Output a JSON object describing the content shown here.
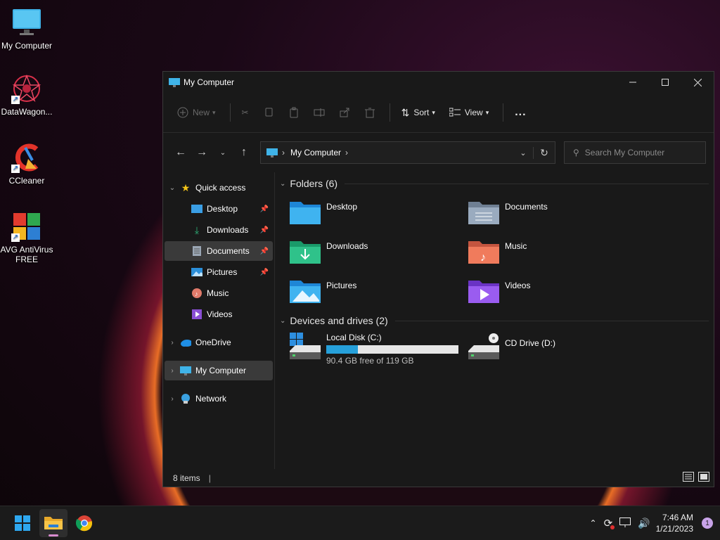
{
  "desktop": {
    "icons": [
      {
        "label": "My Computer"
      },
      {
        "label": "DataWagon..."
      },
      {
        "label": "CCleaner"
      },
      {
        "label": "AVG AntiVirus FREE"
      }
    ]
  },
  "window": {
    "title": "My Computer",
    "toolbar": {
      "new_label": "New",
      "sort_label": "Sort",
      "view_label": "View",
      "more_label": "..."
    },
    "address": {
      "crumb": "My Computer"
    },
    "search": {
      "placeholder": "Search My Computer"
    },
    "nav": {
      "quick_access": "Quick access",
      "desktop": "Desktop",
      "downloads": "Downloads",
      "documents": "Documents",
      "pictures": "Pictures",
      "music": "Music",
      "videos": "Videos",
      "onedrive": "OneDrive",
      "my_computer": "My Computer",
      "network": "Network"
    },
    "content": {
      "folders_header": "Folders (6)",
      "devices_header": "Devices and drives (2)",
      "folders": {
        "desktop": "Desktop",
        "documents": "Documents",
        "downloads": "Downloads",
        "music": "Music",
        "pictures": "Pictures",
        "videos": "Videos"
      },
      "drive_c": {
        "name": "Local Disk (C:)",
        "free_text": "90.4 GB free of 119 GB",
        "used_fraction": 0.24
      },
      "drive_d": {
        "name": "CD Drive (D:)"
      }
    },
    "status": {
      "items": "8 items"
    }
  },
  "taskbar": {
    "time": "7:46 AM",
    "date": "1/21/2023",
    "notifications": "1"
  },
  "colors": {
    "accent": "#26a0da",
    "window_bg": "#191919",
    "selection": "#3a3a3a"
  }
}
